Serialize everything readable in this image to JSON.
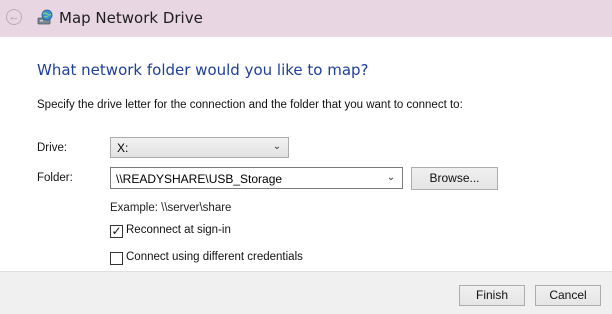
{
  "window": {
    "title": "Map Network Drive",
    "back_icon": "back-arrow-icon",
    "app_icon": "network-drive-icon"
  },
  "main": {
    "heading": "What network folder would you like to map?",
    "instruction": "Specify the drive letter for the connection and the folder that you want to connect to:",
    "drive_label": "Drive:",
    "drive_value": "X:",
    "folder_label": "Folder:",
    "folder_value": "\\\\READYSHARE\\USB_Storage",
    "browse_label": "Browse...",
    "example_text": "Example: \\\\server\\share",
    "reconnect_label": "Reconnect at sign-in",
    "reconnect_checked": true,
    "credentials_label": "Connect using different credentials",
    "credentials_checked": false
  },
  "footer": {
    "finish_label": "Finish",
    "cancel_label": "Cancel"
  },
  "colors": {
    "titlebar": "#e8d7e2",
    "heading": "#1e3f9a",
    "footer": "#f0f0f0"
  }
}
